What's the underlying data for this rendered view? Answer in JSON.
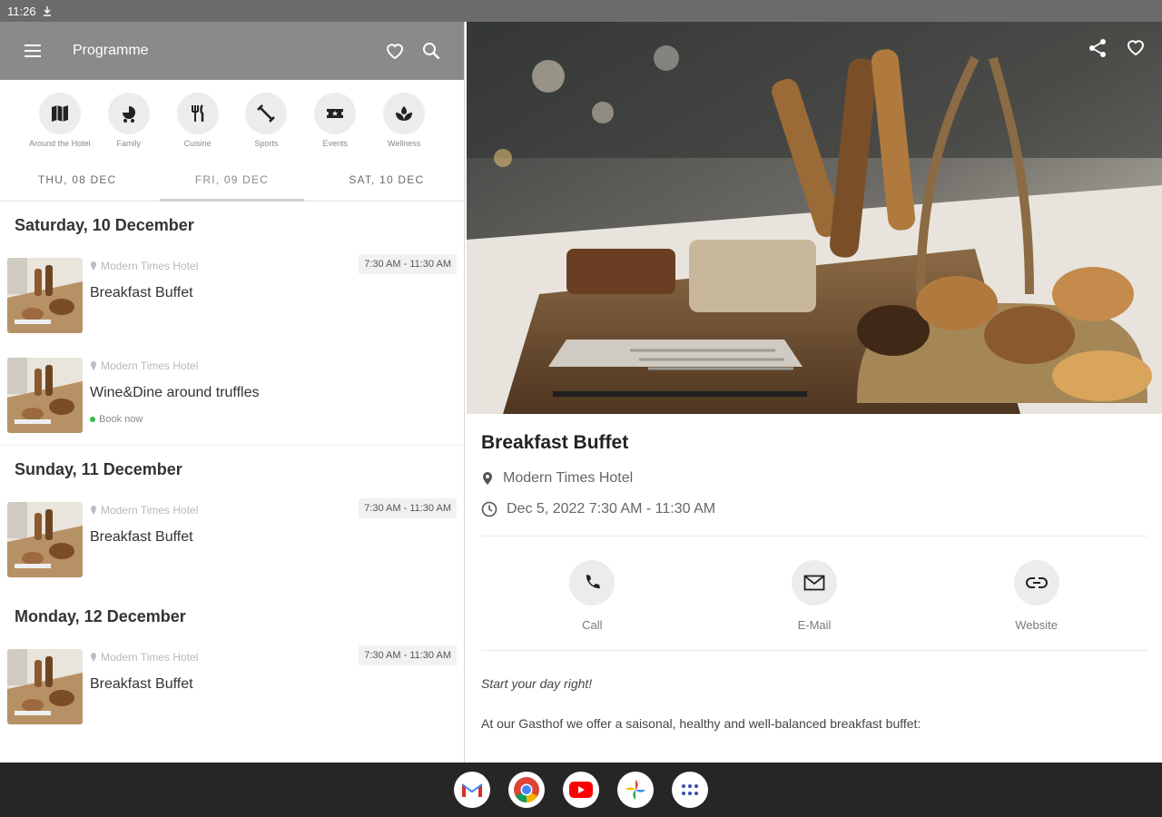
{
  "status_bar": {
    "time": "11:26"
  },
  "left": {
    "app_title": "Programme",
    "categories": [
      {
        "label": "Around the Hotel",
        "icon": "map-icon"
      },
      {
        "label": "Family",
        "icon": "stroller-icon"
      },
      {
        "label": "Cuisine",
        "icon": "cutlery-icon"
      },
      {
        "label": "Sports",
        "icon": "fitness-icon"
      },
      {
        "label": "Events",
        "icon": "ticket-icon"
      },
      {
        "label": "Wellness",
        "icon": "spa-icon"
      }
    ],
    "day_tabs": [
      "THU, 08 DEC",
      "FRI, 09 DEC",
      "SAT, 10 DEC"
    ],
    "days": [
      {
        "heading": "Saturday, 10 December",
        "events": [
          {
            "location": "Modern Times Hotel",
            "title": "Breakfast Buffet",
            "time": "7:30 AM - 11:30 AM"
          },
          {
            "location": "Modern Times Hotel",
            "title": "Wine&Dine around truffles",
            "book": "Book now"
          }
        ]
      },
      {
        "heading": "Sunday, 11 December",
        "events": [
          {
            "location": "Modern Times Hotel",
            "title": "Breakfast Buffet",
            "time": "7:30 AM - 11:30 AM"
          }
        ]
      },
      {
        "heading": "Monday, 12 December",
        "events": [
          {
            "location": "Modern Times Hotel",
            "title": "Breakfast Buffet",
            "time": "7:30 AM - 11:30 AM"
          }
        ]
      }
    ]
  },
  "detail": {
    "title": "Breakfast Buffet",
    "location": "Modern Times Hotel",
    "datetime": "Dec 5, 2022 7:30 AM - 11:30 AM",
    "actions": [
      {
        "label": "Call",
        "icon": "phone-icon"
      },
      {
        "label": "E-Mail",
        "icon": "email-icon"
      },
      {
        "label": "Website",
        "icon": "link-icon"
      }
    ],
    "tagline": "Start your day right!",
    "description": "At our Gasthof we offer a saisonal, healthy and well-balanced breakfast buffet:"
  },
  "dock": [
    "Gmail",
    "Chrome",
    "YouTube",
    "Photos",
    "App drawer"
  ]
}
